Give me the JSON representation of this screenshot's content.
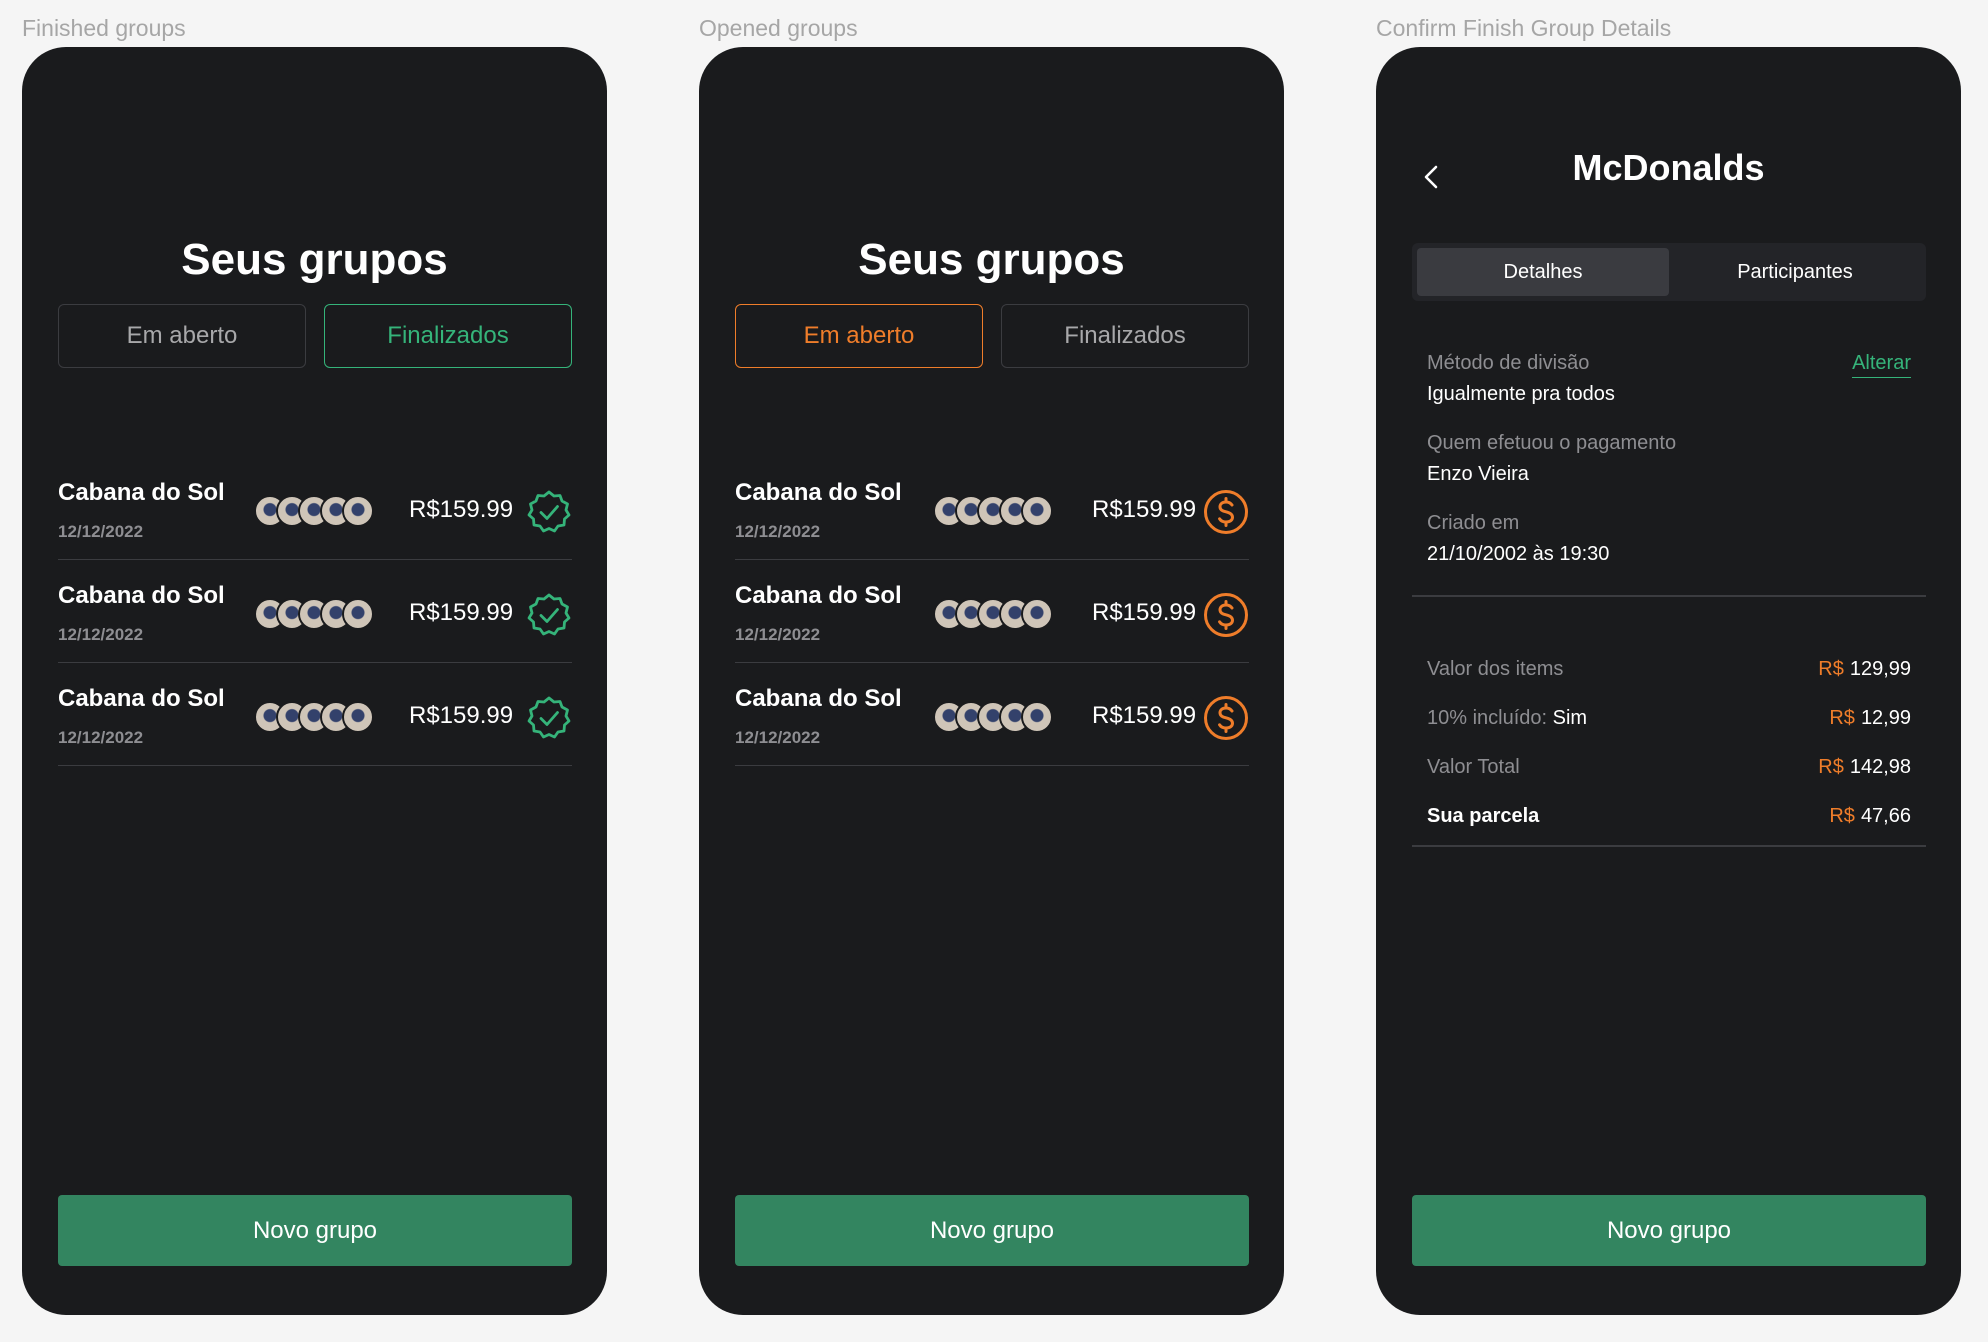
{
  "frames": {
    "finished_label": "Finished groups",
    "opened_label": "Opened groups",
    "confirm_label": "Confirm Finish Group Details"
  },
  "groups_screen": {
    "title": "Seus grupos",
    "tab_open": "Em aberto",
    "tab_finished": "Finalizados",
    "new_group": "Novo grupo"
  },
  "finished_groups": [
    {
      "name": "Cabana do Sol",
      "date": "12/12/2022",
      "price": "R$159.99",
      "status_icon": "verified-check-icon"
    },
    {
      "name": "Cabana do Sol",
      "date": "12/12/2022",
      "price": "R$159.99",
      "status_icon": "verified-check-icon"
    },
    {
      "name": "Cabana do Sol",
      "date": "12/12/2022",
      "price": "R$159.99",
      "status_icon": "verified-check-icon"
    }
  ],
  "opened_groups": [
    {
      "name": "Cabana do Sol",
      "date": "12/12/2022",
      "price": "R$159.99",
      "status_icon": "dollar-circle-icon"
    },
    {
      "name": "Cabana do Sol",
      "date": "12/12/2022",
      "price": "R$159.99",
      "status_icon": "dollar-circle-icon"
    },
    {
      "name": "Cabana do Sol",
      "date": "12/12/2022",
      "price": "R$159.99",
      "status_icon": "dollar-circle-icon"
    }
  ],
  "details": {
    "title": "McDonalds",
    "tabs": [
      "Detalhes",
      "Participantes"
    ],
    "split_method_label": "Método de divisão",
    "split_method_value": "Igualmente pra todos",
    "change_label": "Alterar",
    "payer_label": "Quem efetuou o pagamento",
    "payer_value": "Enzo Vieira",
    "created_label": "Criado em",
    "created_value": "21/10/2002 às 19:30",
    "totals": [
      {
        "label": "Valor dos items",
        "currency": "R$",
        "amount": "129,99"
      },
      {
        "label": "10% incluído:",
        "emphasis": "Sim",
        "currency": "R$",
        "amount": "12,99"
      },
      {
        "label": "Valor Total",
        "currency": "R$",
        "amount": "142,98"
      },
      {
        "label": "Sua parcela",
        "currency": "R$",
        "amount": "47,66"
      }
    ],
    "new_group": "Novo grupo"
  },
  "colors": {
    "background": "#f5f5f5",
    "phone": "#1a1b1d",
    "green": "#35b47a",
    "orange": "#ef7d2a",
    "button": "#338560"
  }
}
